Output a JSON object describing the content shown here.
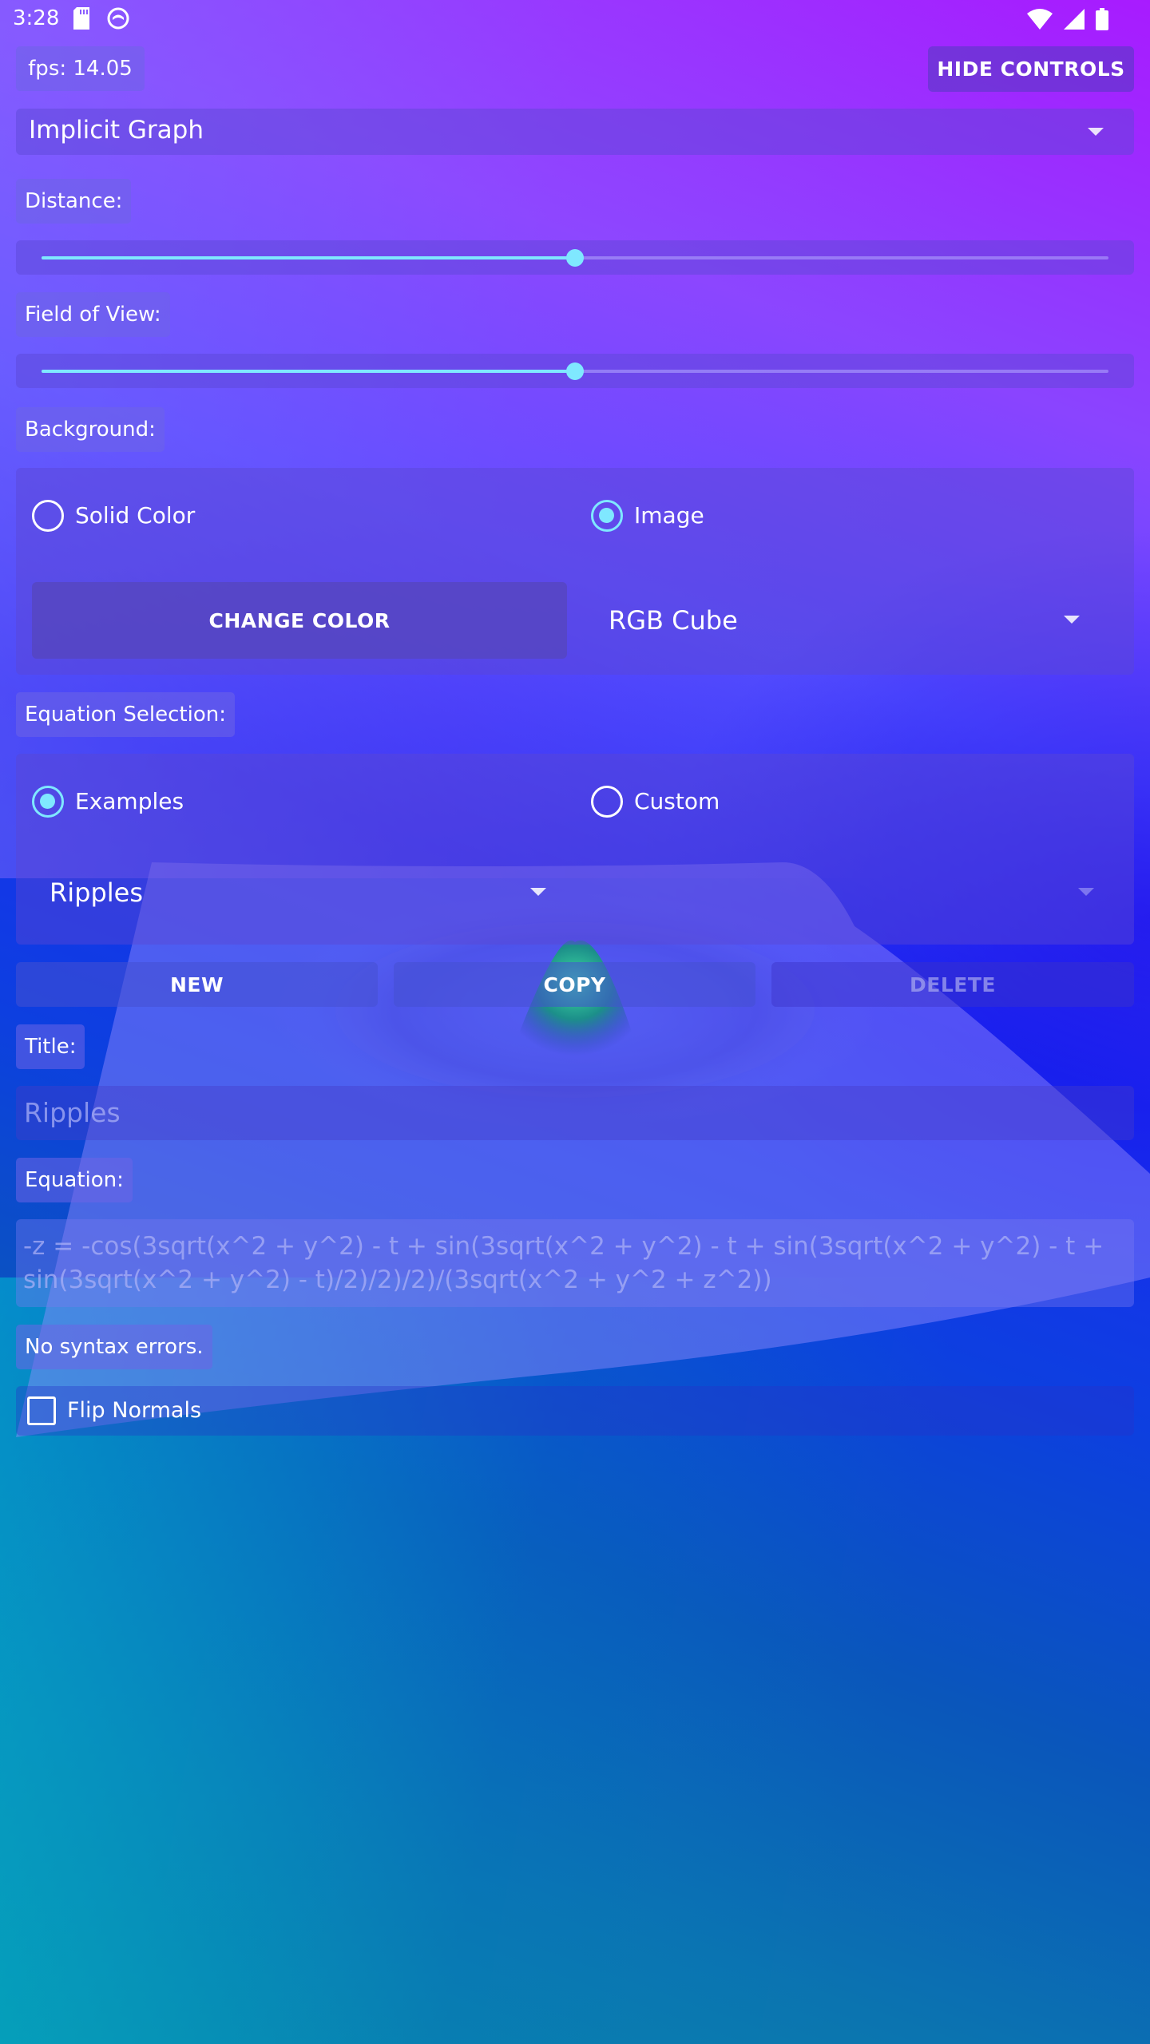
{
  "status_bar": {
    "time": "3:28",
    "left_icons": [
      "sd-card-icon",
      "notification-app-icon"
    ],
    "right_icons": [
      "wifi-icon",
      "cell-signal-icon",
      "battery-icon"
    ]
  },
  "header": {
    "fps_label": "fps: 14.05",
    "hide_controls_label": "HIDE CONTROLS"
  },
  "graph_type": {
    "selected": "Implicit Graph"
  },
  "distance": {
    "label": "Distance:",
    "value_fraction": 0.5
  },
  "field_of_view": {
    "label": "Field of View:",
    "value_fraction": 0.5
  },
  "background": {
    "label": "Background:",
    "options": [
      "Solid Color",
      "Image"
    ],
    "selected": "Image",
    "change_color_label": "CHANGE COLOR",
    "image_selected": "RGB Cube"
  },
  "equation_selection": {
    "label": "Equation Selection:",
    "options": [
      "Examples",
      "Custom"
    ],
    "selected": "Examples",
    "example_selected": "Ripples",
    "new_label": "NEW",
    "copy_label": "COPY",
    "delete_label": "DELETE"
  },
  "title": {
    "label": "Title:",
    "value": "Ripples"
  },
  "equation": {
    "label": "Equation:",
    "line1": "-z = -cos(3sqrt(x^2 + y^2) - t + sin(3sqrt(x^2 + y^2) - t + sin(3sqrt(x^2 + y^2) - t +",
    "line2": "sin(3sqrt(x^2 + y^2) - t)/2)/2)/2)/(3sqrt(x^2 + y^2 + z^2))"
  },
  "syntax_status": "No syntax errors.",
  "flip_normals": {
    "label": "Flip Normals",
    "checked": false
  },
  "colors": {
    "accent": "#7fe8ff",
    "panel": "#5a46d2",
    "background_top": "#a81bff",
    "background_bottom": "#0a8aa5"
  }
}
